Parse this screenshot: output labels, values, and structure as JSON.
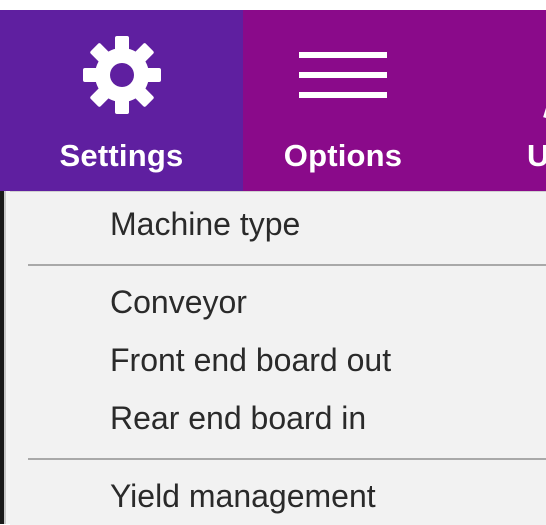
{
  "toolbar": {
    "buttons": [
      {
        "label": "Settings",
        "icon": "gear-icon",
        "selected": true
      },
      {
        "label": "Options",
        "icon": "menu-lines-icon",
        "selected": false
      },
      {
        "label": "U",
        "icon": "partial-icon",
        "selected": false
      }
    ],
    "colors": {
      "bar": "#8a0a8a",
      "selected": "#5f1fa0",
      "text": "#ffffff"
    }
  },
  "menu": {
    "items": [
      {
        "label": "Machine type"
      },
      {
        "label": "Conveyor"
      },
      {
        "label": "Front end board out"
      },
      {
        "label": "Rear end board in"
      },
      {
        "label": "Yield management"
      }
    ],
    "background": "#f2f2f2"
  }
}
